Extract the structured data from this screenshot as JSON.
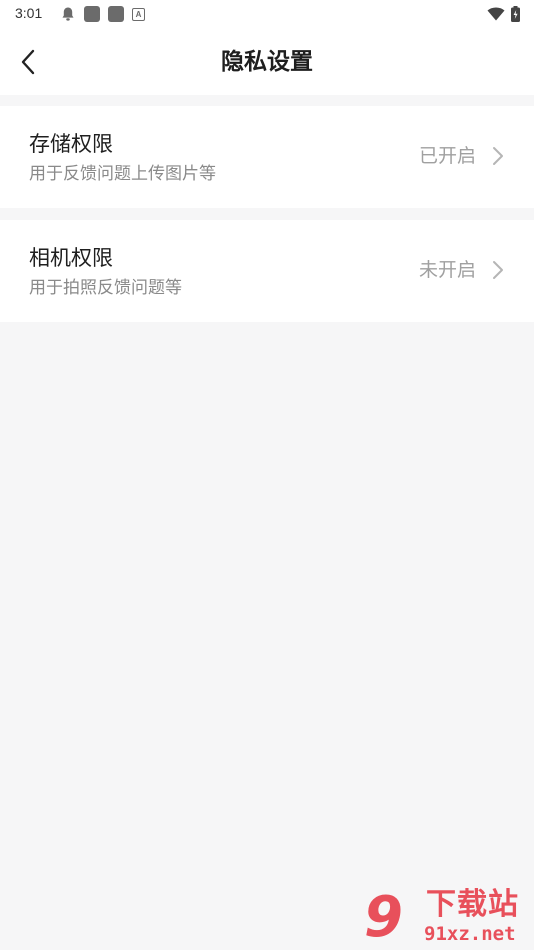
{
  "status_bar": {
    "time": "3:01",
    "left_icons": [
      "notification-icon",
      "app-icon",
      "app-icon",
      "keyboard-icon"
    ],
    "keyboard_glyph": "A",
    "right_icons": [
      "wifi-icon",
      "battery-icon"
    ]
  },
  "header": {
    "title": "隐私设置",
    "back_icon": "chevron-left-icon"
  },
  "permissions": [
    {
      "title": "存储权限",
      "subtitle": "用于反馈问题上传图片等",
      "status": "已开启"
    },
    {
      "title": "相机权限",
      "subtitle": "用于拍照反馈问题等",
      "status": "未开启"
    }
  ],
  "watermark": {
    "logo_mark": "9",
    "text": "下载站",
    "domain": "91xz.net"
  },
  "colors": {
    "background": "#f6f6f7",
    "surface": "#ffffff",
    "title_text": "#1e1e1e",
    "secondary_text": "#8a8a8a",
    "status_text": "#a0a0a0",
    "watermark": "#e8505b"
  }
}
